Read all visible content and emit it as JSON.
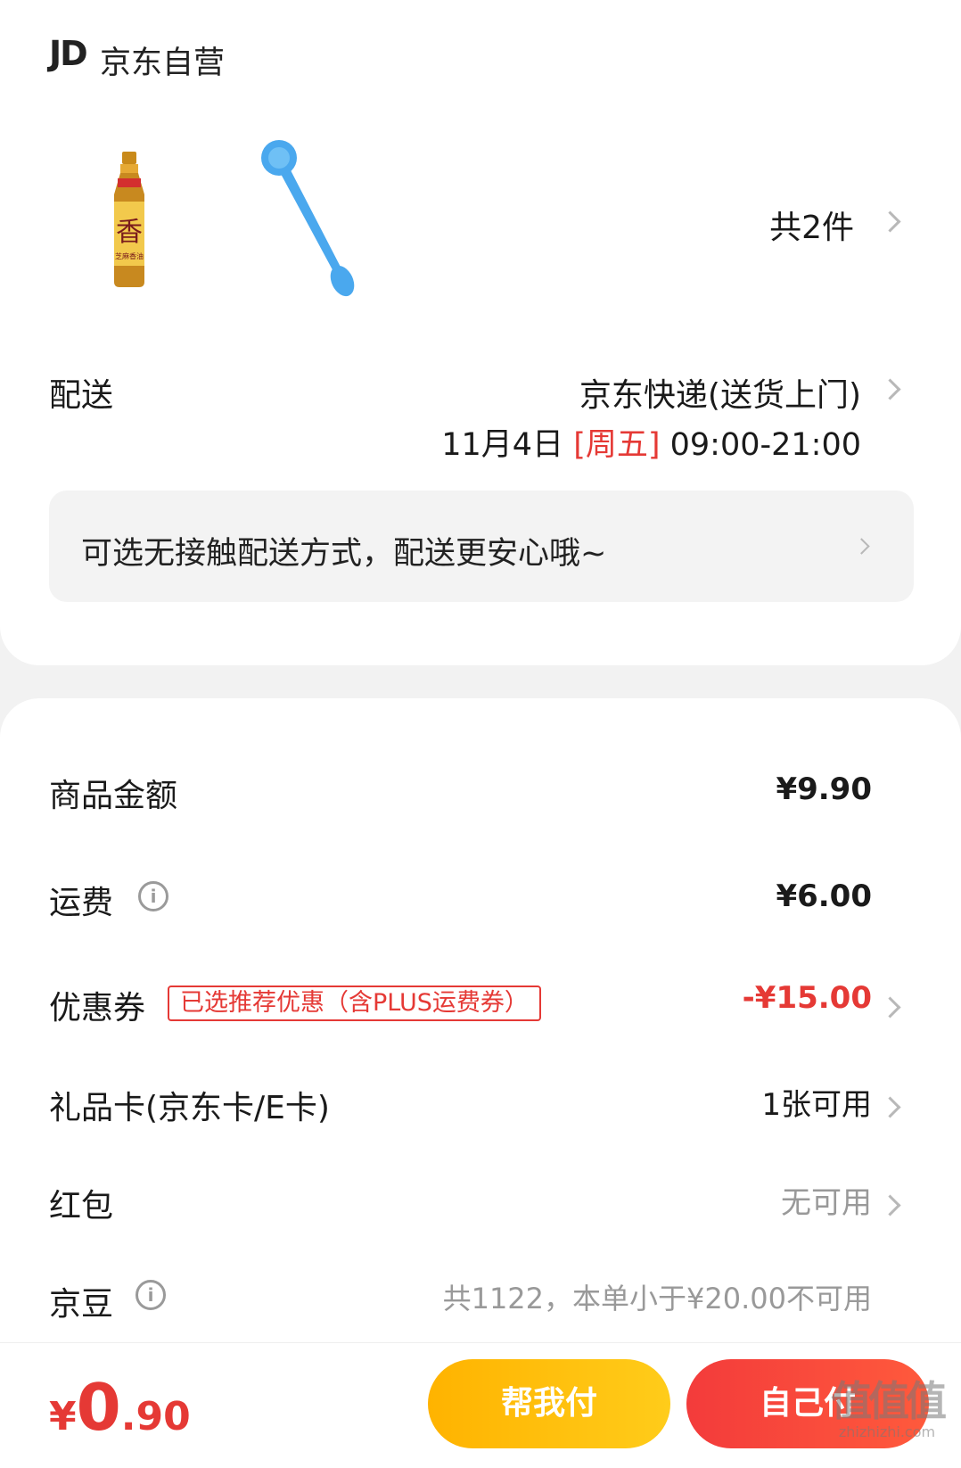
{
  "store": {
    "logo": "JD",
    "name": "京东自营"
  },
  "products": {
    "count_label": "共2件",
    "items": [
      {
        "name": "芝麻香油",
        "label": "香",
        "sub": "芝麻香油"
      },
      {
        "name": "量勺"
      }
    ]
  },
  "delivery": {
    "label": "配送",
    "method": "京东快递(送货上门)",
    "date": "11月4日",
    "weekday": "[周五]",
    "time": "09:00-21:00",
    "contactless": "可选无接触配送方式，配送更安心哦~"
  },
  "summary": {
    "goods_amount": {
      "label": "商品金额",
      "value": "¥9.90"
    },
    "shipping": {
      "label": "运费",
      "value": "¥6.00"
    },
    "coupon": {
      "label": "优惠券",
      "tag": "已选推荐优惠（含PLUS运费券）",
      "value": "-¥15.00"
    },
    "gift_card": {
      "label": "礼品卡(京东卡/E卡)",
      "value": "1张可用"
    },
    "red_packet": {
      "label": "红包",
      "value": "无可用"
    },
    "jd_beans": {
      "label": "京豆",
      "value": "共1122，本单小于¥20.00不可用"
    }
  },
  "footer": {
    "total": {
      "currency": "¥",
      "int": "0",
      "dec": ".90"
    },
    "help_pay": "帮我付",
    "self_pay": "自己付"
  },
  "watermark": {
    "logo": "值值值",
    "url": "zhizhizhi.com"
  },
  "colors": {
    "accent_red": "#e53935",
    "help_pay_yellow": "#ffb300",
    "self_pay_red": "#f33b3b"
  }
}
